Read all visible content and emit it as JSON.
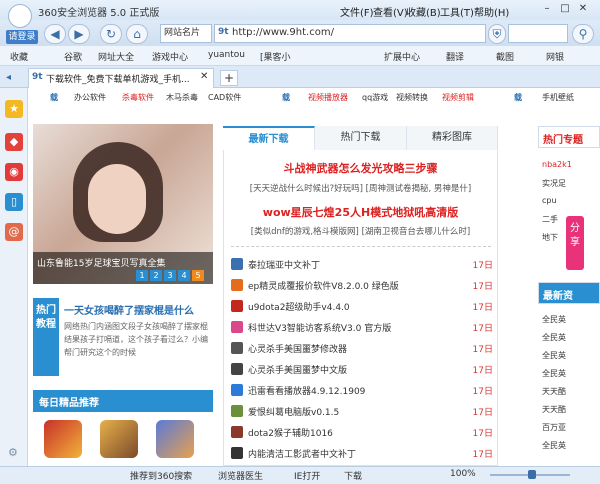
{
  "window": {
    "title": "360安全浏览器 5.0 正式版"
  },
  "menu": [
    "文件(F)",
    "查看(V)",
    "收藏(B)",
    "工具(T)",
    "帮助(H)"
  ],
  "nav": {
    "login": "请登录",
    "site_select": "网站名片",
    "url": "http://www.9ht.com/"
  },
  "bookmarks": [
    "收藏",
    "谷歌",
    "网址大全",
    "游戏中心",
    "yuantou",
    "[果客小",
    "扩展中心",
    "翻译",
    "截图",
    "网银"
  ],
  "tab": {
    "title": "下载软件_免费下载单机游戏_手机..."
  },
  "category_row": {
    "left": [
      "载",
      "办公软件",
      "杀毒软件",
      "木马杀毒",
      "CAD软件"
    ],
    "mid": [
      "载",
      "视频播放器",
      "qq游戏",
      "视频转换",
      "视频剪辑"
    ],
    "right": [
      "载",
      "手机壁纸"
    ]
  },
  "hero": {
    "caption": "山东鲁能15岁足球宝贝写真全集",
    "pages": [
      "1",
      "2",
      "3",
      "4",
      "5"
    ]
  },
  "hot": {
    "side": "热门教程",
    "title": "一天女孩喝醉了摆家棍是什么",
    "desc": "网络热门内涵图文段子女孩喝醉了摆家棍结果孩子打嗝道，这个孩子看过么？小编帮门研究这个的时候"
  },
  "daily": {
    "title": "每日精品推荐"
  },
  "tabs": [
    "最新下载",
    "热门下载",
    "精彩图库"
  ],
  "headline1": "斗战神武器怎么发光攻略三步骤",
  "sub1": "[天天逆战什么时候出?好玩吗]  [周神测试卷揭秘, 男神是什]",
  "headline2": "wow星辰七煌25人H模式地狱吼高清版",
  "sub2": "[类似dnf的游戏,格斗模版网]  [湖南卫视音台去哪儿什么时]",
  "list": [
    {
      "name": "泰拉瑞亚中文补丁",
      "date": "17日",
      "color": "#3a6fb0"
    },
    {
      "name": "ep精灵成覆报价软件V8.2.0.0 绿色版",
      "date": "17日",
      "color": "#e36d1c"
    },
    {
      "name": "u9dota2超级助手v4.4.0",
      "date": "17日",
      "color": "#c2261c"
    },
    {
      "name": "科世达V3智能访客系统V3.0 官方版",
      "date": "17日",
      "color": "#d9488a"
    },
    {
      "name": "心灵杀手美国噩梦修改器",
      "date": "17日",
      "color": "#555"
    },
    {
      "name": "心灵杀手美国噩梦中文版",
      "date": "17日",
      "color": "#444"
    },
    {
      "name": "迅雷看看播放器4.9.12.1909",
      "date": "17日",
      "color": "#2d7bd8"
    },
    {
      "name": "爱恨纠葛电脑版v0.1.5",
      "date": "17日",
      "color": "#6c8f3a"
    },
    {
      "name": "dota2猴子辅助1016",
      "date": "17日",
      "color": "#8a3a2a"
    },
    {
      "name": "内能清洁工影武者中文补丁",
      "date": "17日",
      "color": "#333"
    }
  ],
  "right_col": {
    "title1": "热门专题",
    "items1": [
      "nba2k1",
      "实况足",
      "cpu",
      "二手",
      "地下"
    ],
    "title2": "最新资",
    "items2": [
      "全民英",
      "全民英",
      "全民英",
      "全民英",
      "天天酷",
      "天天酷",
      "百万亚",
      "全民英"
    ]
  },
  "share": "分享",
  "status": {
    "items": [
      "推荐到360搜索",
      "浏览器医生",
      "IE打开",
      "下载",
      "100%"
    ]
  }
}
